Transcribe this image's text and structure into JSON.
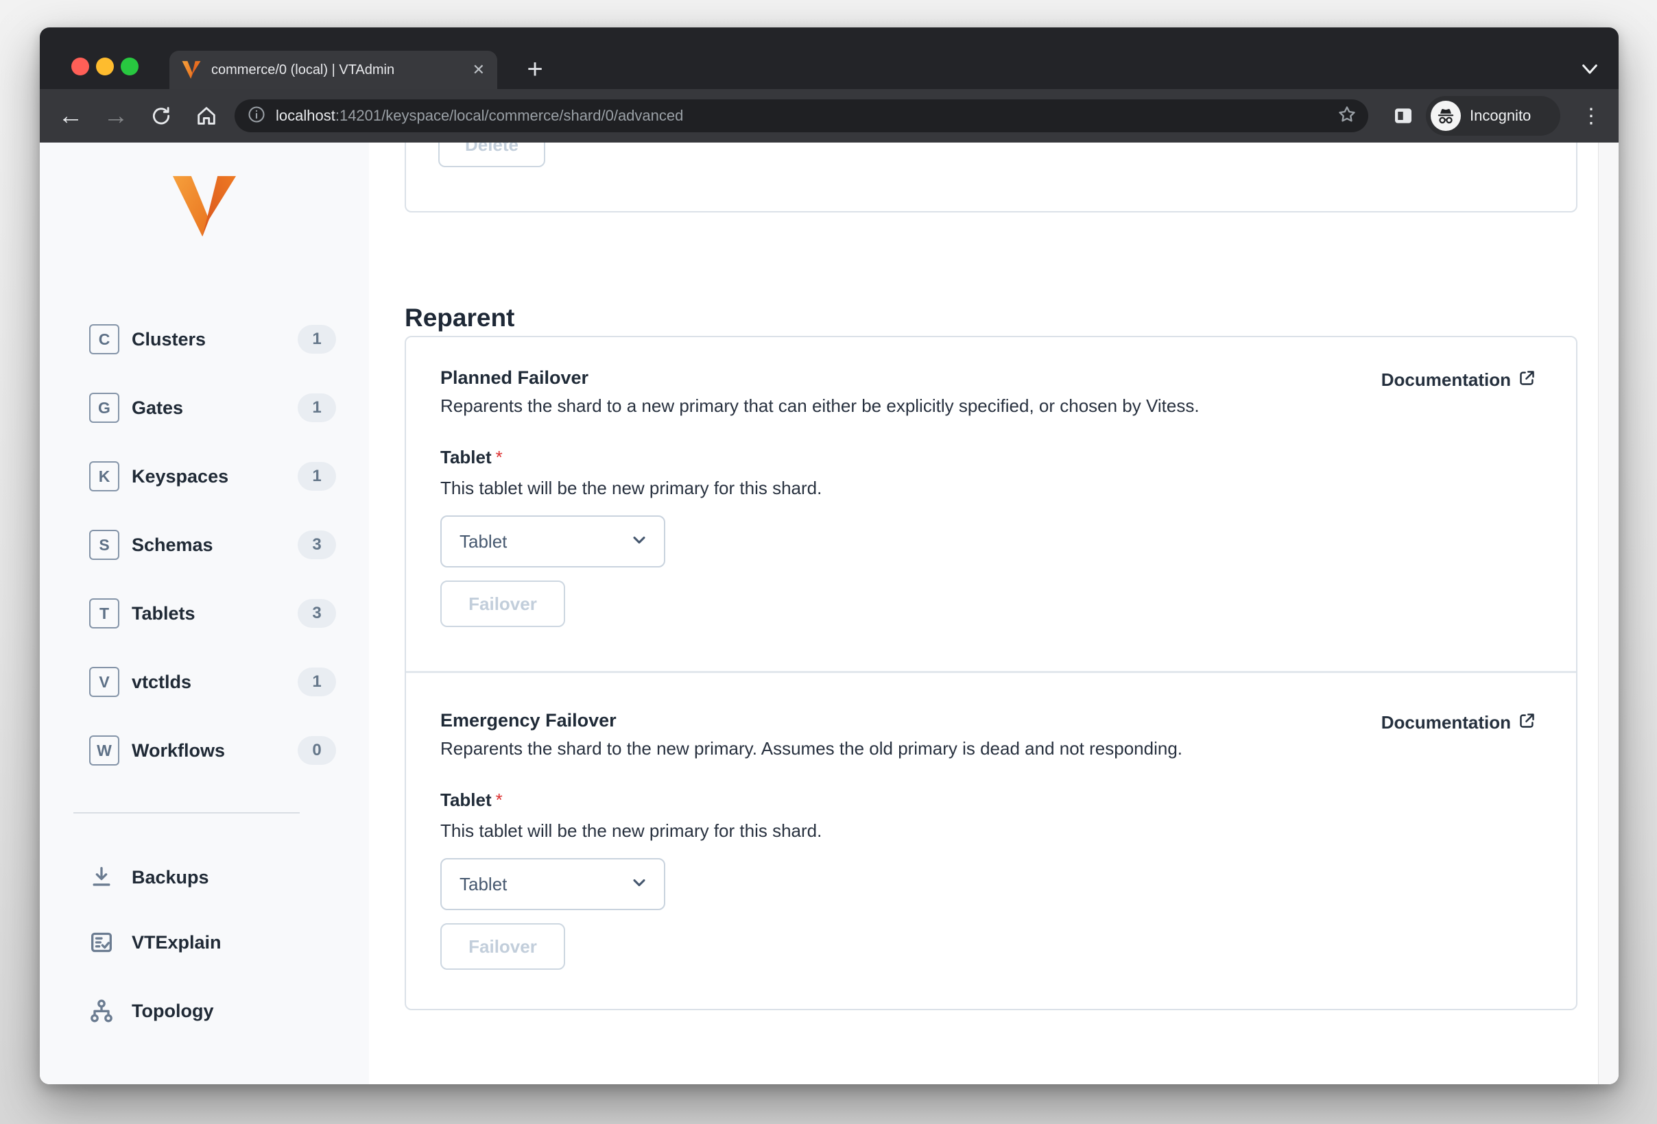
{
  "browser": {
    "tab_title": "commerce/0 (local) | VTAdmin",
    "close_glyph": "✕",
    "new_tab_glyph": "+",
    "back_glyph": "←",
    "forward_glyph": "→",
    "menu_glyph": "⋮",
    "url": {
      "host": "localhost",
      "path": ":14201/keyspace/local/commerce/shard/0/advanced"
    },
    "incognito_label": "Incognito"
  },
  "sidebar": {
    "items": [
      {
        "letter": "C",
        "label": "Clusters",
        "count": "1"
      },
      {
        "letter": "G",
        "label": "Gates",
        "count": "1"
      },
      {
        "letter": "K",
        "label": "Keyspaces",
        "count": "1"
      },
      {
        "letter": "S",
        "label": "Schemas",
        "count": "3"
      },
      {
        "letter": "T",
        "label": "Tablets",
        "count": "3"
      },
      {
        "letter": "V",
        "label": "vtctlds",
        "count": "1"
      },
      {
        "letter": "W",
        "label": "Workflows",
        "count": "0"
      }
    ],
    "tools": [
      {
        "icon": "download-icon",
        "label": "Backups"
      },
      {
        "icon": "document-check-icon",
        "label": "VTExplain"
      },
      {
        "icon": "topology-icon",
        "label": "Topology"
      }
    ]
  },
  "main": {
    "top_card": {
      "delete_label": "Delete"
    },
    "section_title": "Reparent",
    "cards": [
      {
        "title": "Planned Failover",
        "description": "Reparents the shard to a new primary that can either be explicitly specified, or chosen by Vitess.",
        "doc_label": "Documentation",
        "field_label": "Tablet",
        "required_marker": "*",
        "field_help": "This tablet will be the new primary for this shard.",
        "select_value": "Tablet",
        "button_label": "Failover"
      },
      {
        "title": "Emergency Failover",
        "description": "Reparents the shard to the new primary. Assumes the old primary is dead and not responding.",
        "doc_label": "Documentation",
        "field_label": "Tablet",
        "required_marker": "*",
        "field_help": "This tablet will be the new primary for this shard.",
        "select_value": "Tablet",
        "button_label": "Failover"
      }
    ]
  },
  "colors": {
    "vitess_orange": "#ed7623",
    "required_red": "#dc2f2f",
    "disabled_text": "#c2cedb",
    "card_border": "#dbe1e8",
    "sidebar_bg": "#f8f9fb",
    "chrome_dark": "#232428",
    "toolbar_dark": "#37383c",
    "traffic_red": "#ff5f57",
    "traffic_yellow": "#febc2e",
    "traffic_green": "#28c840"
  }
}
